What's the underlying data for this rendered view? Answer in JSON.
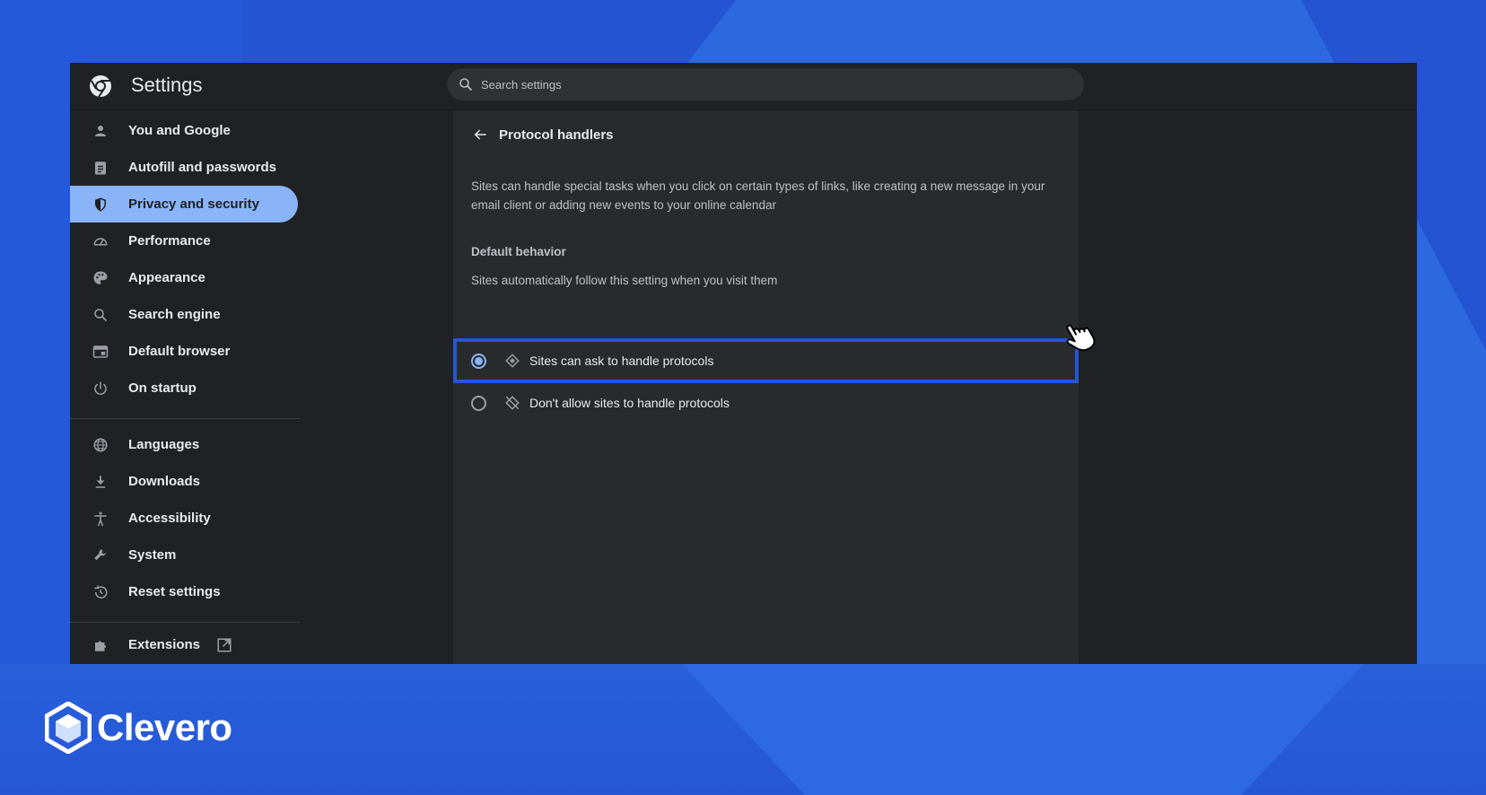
{
  "app": {
    "title": "Settings",
    "search_placeholder": "Search settings"
  },
  "sidebar": {
    "items": [
      {
        "label": "You and Google",
        "icon": "person-icon"
      },
      {
        "label": "Autofill and passwords",
        "icon": "clipboard-icon"
      },
      {
        "label": "Privacy and security",
        "icon": "shield-icon",
        "active": true
      },
      {
        "label": "Performance",
        "icon": "speedometer-icon"
      },
      {
        "label": "Appearance",
        "icon": "palette-icon"
      },
      {
        "label": "Search engine",
        "icon": "search-icon"
      },
      {
        "label": "Default browser",
        "icon": "browser-icon"
      },
      {
        "label": "On startup",
        "icon": "power-icon"
      },
      {
        "label": "Languages",
        "icon": "globe-icon"
      },
      {
        "label": "Downloads",
        "icon": "download-icon"
      },
      {
        "label": "Accessibility",
        "icon": "accessibility-icon"
      },
      {
        "label": "System",
        "icon": "wrench-icon"
      },
      {
        "label": "Reset settings",
        "icon": "history-icon"
      },
      {
        "label": "Extensions",
        "icon": "puzzle-icon"
      }
    ]
  },
  "page": {
    "title": "Protocol handlers",
    "description": "Sites can handle special tasks when you click on certain types of links, like creating a new message in your email client or adding new events to your online calendar",
    "default_behavior_label": "Default behavior",
    "default_behavior_sub": "Sites automatically follow this setting when you visit them",
    "options": [
      {
        "label": "Sites can ask to handle protocols",
        "icon": "protocol-handler-icon",
        "selected": true
      },
      {
        "label": "Don't allow sites to handle protocols",
        "icon": "protocol-handler-off-icon",
        "selected": false
      }
    ]
  },
  "brand": {
    "name": "Clevero"
  },
  "colors": {
    "background": "#2454d3",
    "window": "#202124",
    "card": "#292a2d",
    "accent": "#8ab4f8",
    "highlight_border": "#2456d6"
  }
}
